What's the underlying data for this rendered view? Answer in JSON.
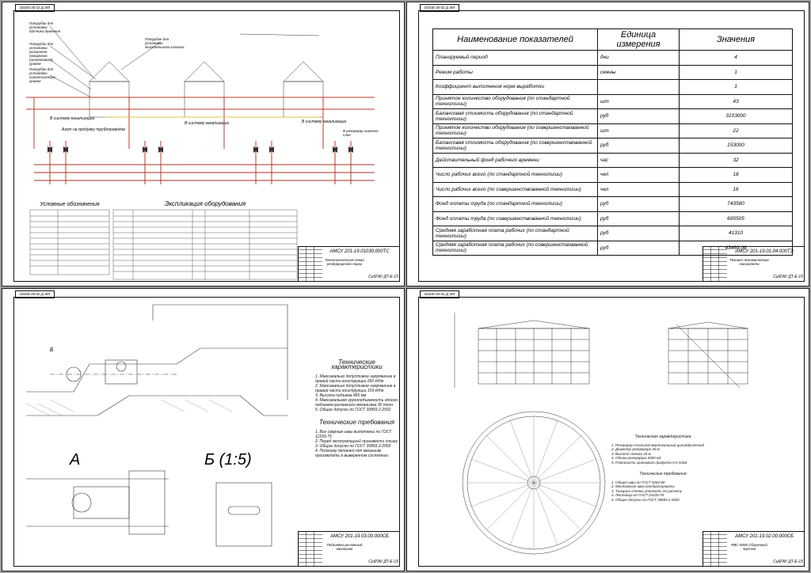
{
  "drawing_code_corner": "DDDD 00 02 Д ЭМ",
  "sheet1": {
    "legend_title": "Условные обозначения",
    "equipment_title": "Экспликация оборудования",
    "callouts": [
      "Патрубок для установки датчика давления",
      "Патрубок для установки указателя пожарного (аналогового) уровня",
      "Патрубок для установки сигнализатора уровня",
      "Патрубок для установки дыхательного клапана",
      "В систему канализации",
      "Азот на продувку трубопроводов",
      "В систему канализации",
      "В систему канализации",
      "В резервуар нижнего слоя"
    ],
    "stamp_code": "АМСУ 201-19.01030.000ТС",
    "stamp_name": "Технологическая схема резервуарного парка",
    "stamp_org": "СибГАУ ДТ-Е-15"
  },
  "sheet2": {
    "stamp_code": "АМСУ 201-19.01.04.000ТЭ",
    "stamp_name": "Технико-экономические показатели",
    "stamp_org": "СибГАУ ДТ-Е-15",
    "table": {
      "headers": [
        "Наименование показателей",
        "Единица измерения",
        "Значения"
      ],
      "rows": [
        [
          "Планируемый период",
          "дни",
          "4"
        ],
        [
          "Режим работы",
          "смены",
          "1"
        ],
        [
          "Коэффициент выполнения норм выработки",
          "",
          "1"
        ],
        [
          "Принятое количество оборудования (по стандартной технологии)",
          "шт",
          "43"
        ],
        [
          "Балансовая стоимость оборудования (по стандартной технологии)",
          "руб",
          "3153000"
        ],
        [
          "Принятое количество оборудования (по совершенствованной технологии)",
          "шт",
          "22"
        ],
        [
          "Балансовая стоимость оборудования (по совершенствованной технологии)",
          "руб",
          "153000"
        ],
        [
          "Действительный фонд рабочего времени",
          "час",
          "32"
        ],
        [
          "Число рабочих всего (по стандартной технологии)",
          "чел",
          "18"
        ],
        [
          "Число рабочих всего (по совершенствованной технологии)",
          "чел",
          "16"
        ],
        [
          "Фонд оплаты труда (по стандартной технологии)",
          "руб",
          "743580"
        ],
        [
          "Фонд оплаты труда (по совершенствованной технологии)",
          "руб",
          "695505"
        ],
        [
          "Средняя заработная плата рабочих (по стандартной технологии)",
          "руб",
          "41310"
        ],
        [
          "Средняя заработная плата рабочих (по совершенствованной технологии)",
          "руб",
          "43469,06"
        ]
      ]
    }
  },
  "sheet3": {
    "tech_title": "Технические характеристики",
    "tech_items": [
      "1. Максимально допустимое напряжение в правой части конструкции 260 кН/м",
      "2. Максимально допустимое напряжение в правой части конструкции 159 кН/м",
      "3. Высота подъема 465 мм",
      "4. Максимальная грузоподъемность одного подъемно-рычажного механизма 30 тонн",
      "5. Общие допуски по ГОСТ 30893.2-2002"
    ],
    "req_title": "Технические требования",
    "req_items": [
      "1. Все сварные швы выполнены по ГОСТ 11533-75",
      "2. Перед эксплуатацией произвести стыку",
      "3. Общие допуски по ГОСТ 30893.2-2002",
      "4. Подгонку деталей под механизм производить в выверенном состоянии"
    ],
    "view_a": "А",
    "view_b": "Б (1:5)",
    "callout_b": "Б",
    "stamp_code": "АМСУ 201-19.03.00.000СБ",
    "stamp_name": "Подъемно-рычажный механизм",
    "stamp_org": "СибГАУ ДТ-Е-15"
  },
  "sheet4": {
    "tech_title": "Техническая характеристика",
    "tech_items": [
      "1. Резервуар стальной вертикальный цилиндрический",
      "2. Диаметр резервуара 30 м",
      "3. Высота стенки 18 м",
      "4. Объем резервуара 5000 м3",
      "5. Плотность хранимого продукта 0,9 т/м3"
    ],
    "req_title": "Технические требования",
    "req_items": [
      "1. Общие швы по ГОСТ 5264-80",
      "2. Монтажные швы контролировать",
      "3. Толщина стенки уточнить по расчету",
      "4. Лестница по ГОСТ 23120-78",
      "5. Общие допуски по ГОСТ 30893.2-2002"
    ],
    "stamp_code": "АМСУ 201-19.02.00.000СБ",
    "stamp_name": "РВС-5000 Сборочный чертеж",
    "stamp_org": "СибГАУ ДТ-Е-15"
  }
}
